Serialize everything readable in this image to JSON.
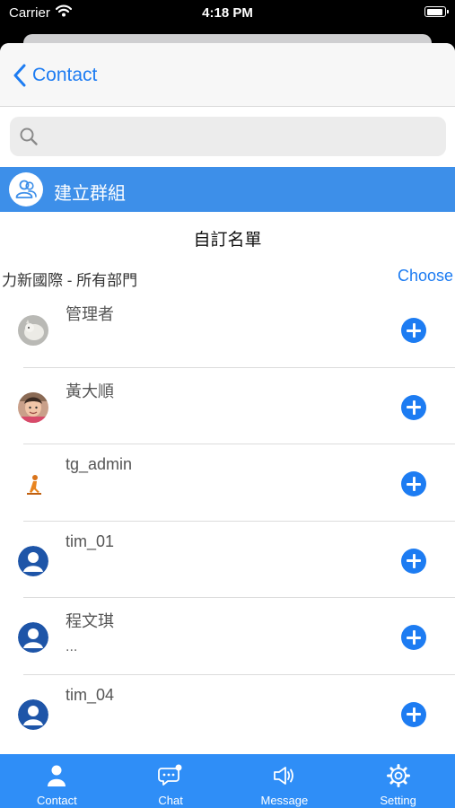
{
  "status_bar": {
    "carrier": "Carrier",
    "time": "4:18 PM"
  },
  "nav": {
    "back_label": "Contact"
  },
  "search": {
    "placeholder": ""
  },
  "group_action": {
    "label": "建立群組"
  },
  "section": {
    "title": "自訂名單"
  },
  "department": {
    "label": "力新國際 - 所有部門",
    "choose_label": "Choose"
  },
  "contacts": [
    {
      "name": "管理者",
      "sub": "",
      "avatar": "photo-cat"
    },
    {
      "name": "黃大順",
      "sub": "",
      "avatar": "photo-person"
    },
    {
      "name": "tg_admin",
      "sub": "",
      "avatar": "figure-orange"
    },
    {
      "name": "tim_01",
      "sub": "",
      "avatar": "default-user"
    },
    {
      "name": "程文琪",
      "sub": "...",
      "avatar": "default-user"
    },
    {
      "name": "tim_04",
      "sub": "",
      "avatar": "default-user"
    }
  ],
  "tabs": [
    {
      "label": "Contact",
      "icon": "contact-icon"
    },
    {
      "label": "Chat",
      "icon": "chat-icon"
    },
    {
      "label": "Message",
      "icon": "megaphone-icon"
    },
    {
      "label": "Setting",
      "icon": "gear-icon"
    }
  ],
  "colors": {
    "accent": "#1d7cf2",
    "group_bar": "#3d8fe9",
    "tab_bar": "#2f8ef7",
    "default_avatar": "#1e55a8"
  }
}
